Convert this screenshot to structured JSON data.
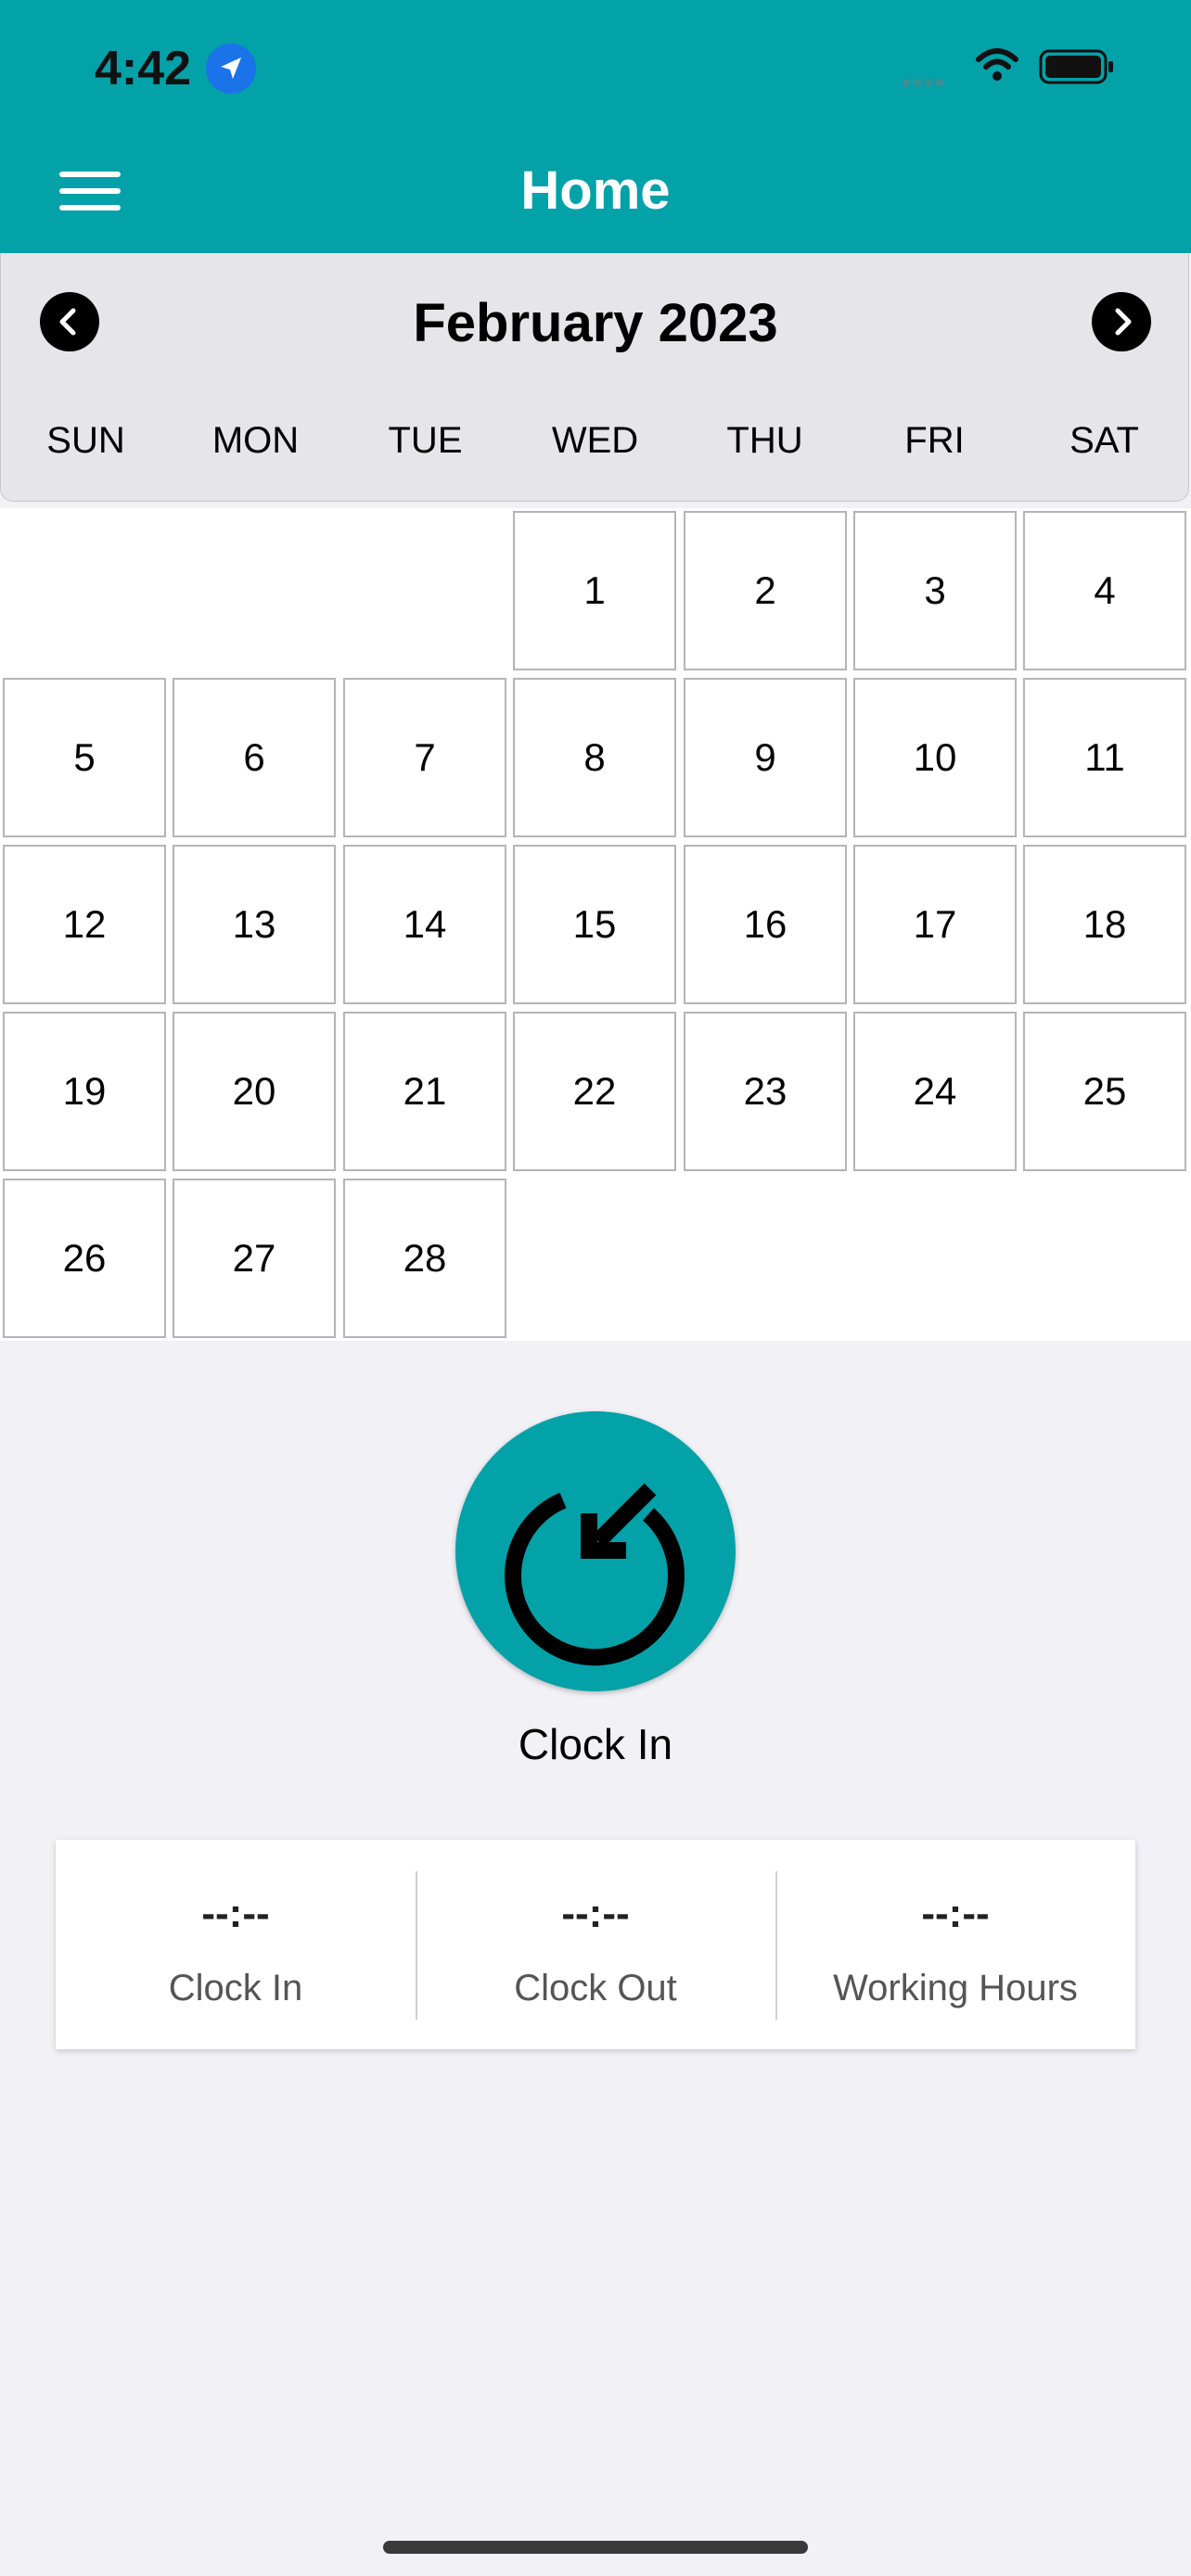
{
  "status_bar": {
    "time": "4:42",
    "location_icon": "location-arrow-icon",
    "signal_icon": "cellular-signal-icon",
    "wifi_icon": "wifi-icon",
    "battery_icon": "battery-icon"
  },
  "header": {
    "title": "Home",
    "menu_icon": "hamburger-menu-icon",
    "background": "#03a1a8"
  },
  "calendar": {
    "month_label": "February 2023",
    "prev_icon": "chevron-left-icon",
    "next_icon": "chevron-right-icon",
    "weekdays": [
      "SUN",
      "MON",
      "TUE",
      "WED",
      "THU",
      "FRI",
      "SAT"
    ],
    "first_weekday_index": 3,
    "days": [
      "1",
      "2",
      "3",
      "4",
      "5",
      "6",
      "7",
      "8",
      "9",
      "10",
      "11",
      "12",
      "13",
      "14",
      "15",
      "16",
      "17",
      "18",
      "19",
      "20",
      "21",
      "22",
      "23",
      "24",
      "25",
      "26",
      "27",
      "28"
    ]
  },
  "clock_action": {
    "icon": "clock-in-icon",
    "label": "Clock In"
  },
  "stats": [
    {
      "value": "--:--",
      "label": "Clock In"
    },
    {
      "value": "--:--",
      "label": "Clock Out"
    },
    {
      "value": "--:--",
      "label": "Working Hours"
    }
  ]
}
